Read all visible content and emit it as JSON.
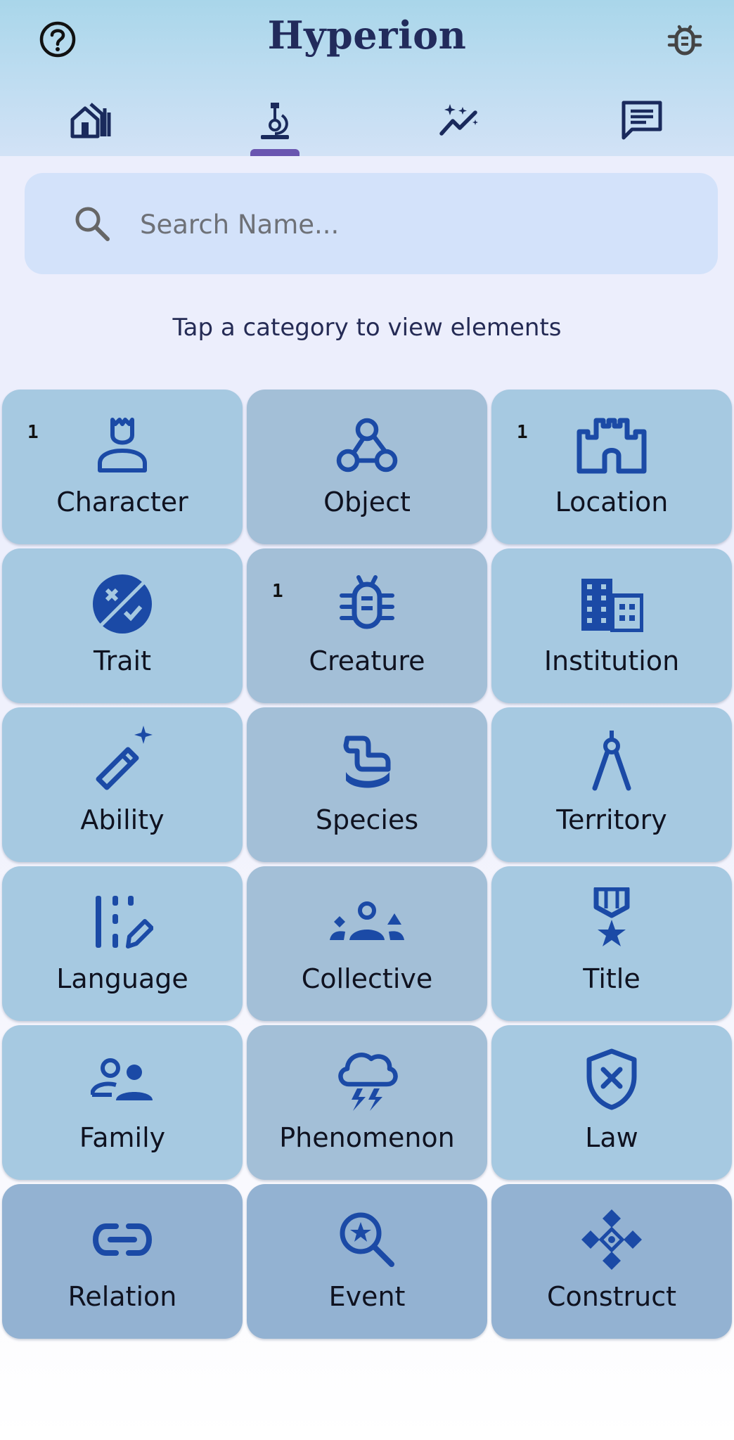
{
  "header": {
    "title": "Hyperion",
    "help_icon": "help-circle-icon",
    "debug_icon": "bug-icon",
    "tabs": [
      {
        "icon": "home-icon",
        "active": false
      },
      {
        "icon": "microscope-icon",
        "active": true
      },
      {
        "icon": "sparkle-chart-icon",
        "active": false
      },
      {
        "icon": "chat-icon",
        "active": false
      }
    ]
  },
  "search": {
    "placeholder": "Search Name...",
    "value": ""
  },
  "hint": "Tap a category to view elements",
  "colors": {
    "accent": "#6a55b0",
    "icon": "#1b4aa6",
    "title": "#222b5c"
  },
  "categories": [
    {
      "label": "Character",
      "count": "1",
      "icon": "character-icon"
    },
    {
      "label": "Object",
      "count": "",
      "icon": "webhook-icon"
    },
    {
      "label": "Location",
      "count": "1",
      "icon": "castle-icon"
    },
    {
      "label": "Trait",
      "count": "",
      "icon": "trait-icon"
    },
    {
      "label": "Creature",
      "count": "1",
      "icon": "bug-icon"
    },
    {
      "label": "Institution",
      "count": "",
      "icon": "building-icon"
    },
    {
      "label": "Ability",
      "count": "",
      "icon": "magic-wand-icon"
    },
    {
      "label": "Species",
      "count": "",
      "icon": "species-icon"
    },
    {
      "label": "Territory",
      "count": "",
      "icon": "compass-icon"
    },
    {
      "label": "Language",
      "count": "",
      "icon": "language-icon"
    },
    {
      "label": "Collective",
      "count": "",
      "icon": "groups-icon"
    },
    {
      "label": "Title",
      "count": "",
      "icon": "medal-icon"
    },
    {
      "label": "Family",
      "count": "",
      "icon": "family-icon"
    },
    {
      "label": "Phenomenon",
      "count": "",
      "icon": "storm-icon"
    },
    {
      "label": "Law",
      "count": "",
      "icon": "shield-x-icon"
    },
    {
      "label": "Relation",
      "count": "",
      "icon": "link-icon"
    },
    {
      "label": "Event",
      "count": "",
      "icon": "search-star-icon"
    },
    {
      "label": "Construct",
      "count": "",
      "icon": "construct-icon"
    }
  ]
}
